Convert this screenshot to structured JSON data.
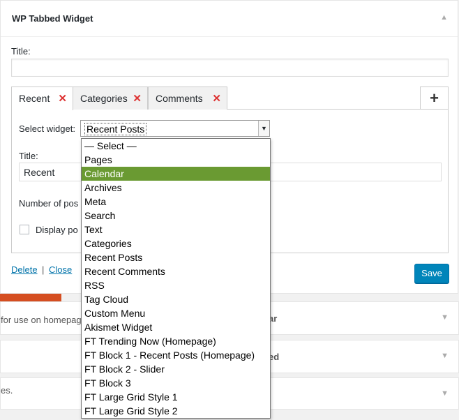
{
  "widget": {
    "title": "WP Tabbed Widget",
    "field_title_label": "Title:",
    "field_title_value": ""
  },
  "tabs": [
    {
      "label": "Recent",
      "close": "✕"
    },
    {
      "label": "Categories",
      "close": "✕"
    },
    {
      "label": "Comments",
      "close": "✕"
    }
  ],
  "add_tab": "+",
  "panel": {
    "select_label": "Select widget:",
    "select_value": "Recent Posts",
    "title_label": "Title:",
    "title_value": "Recent",
    "number_label": "Number of pos",
    "display_label": "Display po"
  },
  "footer": {
    "delete": "Delete",
    "separator": "|",
    "close": "Close",
    "save": "Save"
  },
  "dropdown": {
    "highlighted": "Calendar",
    "options": [
      "— Select —",
      "Pages",
      "Calendar",
      "Archives",
      "Meta",
      "Search",
      "Text",
      "Categories",
      "Recent Posts",
      "Recent Comments",
      "RSS",
      "Tag Cloud",
      "Custom Menu",
      "Akismet Widget",
      "FT Trending Now (Homepage)",
      "FT Block 1 - Recent Posts (Homepage)",
      "FT Block 2 - Slider",
      "FT Block 3",
      "FT Large Grid Style 1",
      "FT Large Grid Style 2"
    ]
  },
  "background": {
    "row1_left": "for use on homepage",
    "row1_right": "ar",
    "row2_right": "ed",
    "row3_left": "es."
  },
  "colors": {
    "accent": "#0085ba",
    "highlight": "#6a9a32",
    "remove": "#dd3333",
    "orange": "#d54e21"
  }
}
